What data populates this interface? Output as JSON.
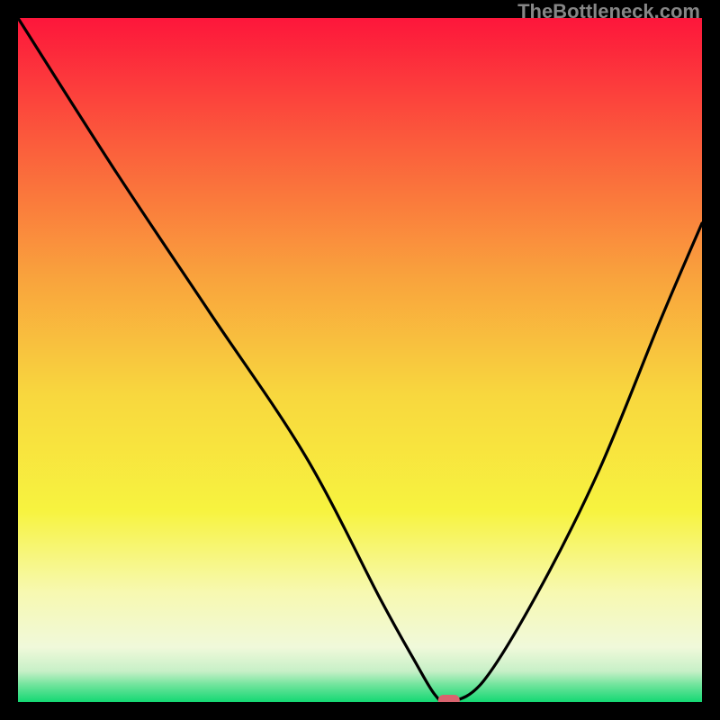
{
  "watermark": "TheBottleneck.com",
  "chart_data": {
    "type": "line",
    "title": "",
    "xlabel": "",
    "ylabel": "",
    "xlim": [
      0,
      100
    ],
    "ylim": [
      0,
      100
    ],
    "series": [
      {
        "name": "curve",
        "x": [
          0,
          14,
          28,
          42,
          53,
          58,
          61,
          63,
          68,
          76,
          85,
          94,
          100
        ],
        "values": [
          100,
          78,
          57,
          36,
          15,
          6,
          1,
          0,
          3,
          16,
          34,
          56,
          70
        ]
      }
    ],
    "marker": {
      "x": 63,
      "y": 0,
      "color": "#d9636e"
    },
    "gradient_stops": [
      {
        "offset": 0.0,
        "color": "#fd163b"
      },
      {
        "offset": 0.18,
        "color": "#fb5b3c"
      },
      {
        "offset": 0.38,
        "color": "#f9a33d"
      },
      {
        "offset": 0.55,
        "color": "#f8d73e"
      },
      {
        "offset": 0.72,
        "color": "#f7f33f"
      },
      {
        "offset": 0.84,
        "color": "#f7f9b1"
      },
      {
        "offset": 0.92,
        "color": "#f0f9da"
      },
      {
        "offset": 0.955,
        "color": "#c7f0c7"
      },
      {
        "offset": 0.975,
        "color": "#70e49c"
      },
      {
        "offset": 1.0,
        "color": "#14d873"
      }
    ]
  }
}
